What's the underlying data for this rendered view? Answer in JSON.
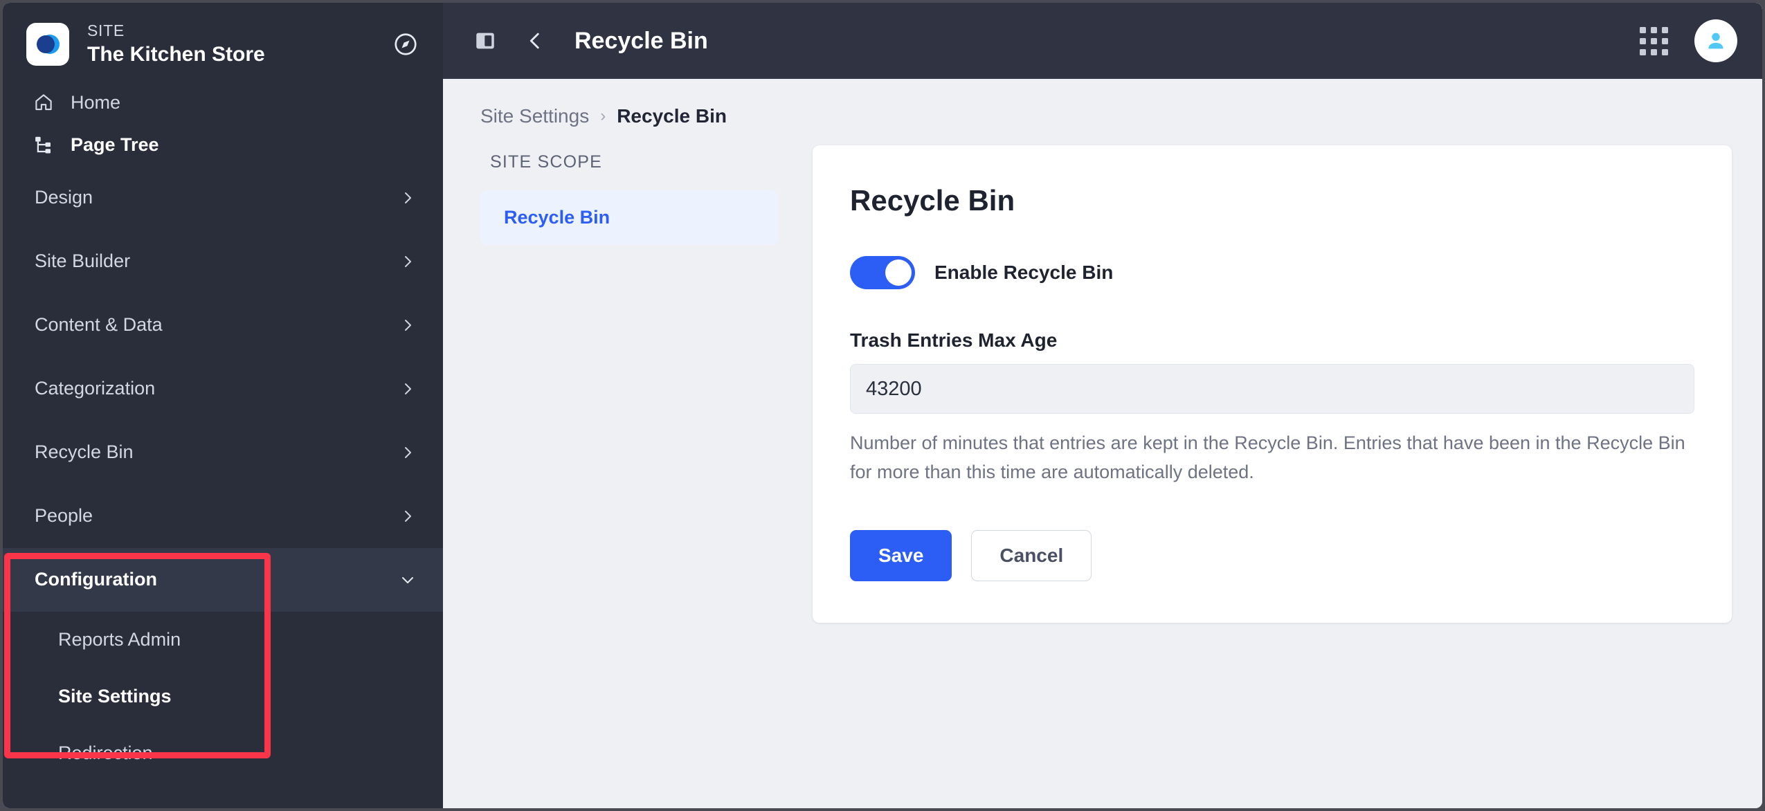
{
  "sidebar": {
    "site_eyebrow": "SITE",
    "site_title": "The Kitchen Store",
    "compass_icon": "compass-icon",
    "top_items": [
      {
        "label": "Home",
        "icon": "home-icon"
      },
      {
        "label": "Page Tree",
        "icon": "page-tree-icon"
      }
    ],
    "groups": [
      {
        "label": "Design",
        "chevron": "chevron-right-icon"
      },
      {
        "label": "Site Builder",
        "chevron": "chevron-right-icon"
      },
      {
        "label": "Content & Data",
        "chevron": "chevron-right-icon"
      },
      {
        "label": "Categorization",
        "chevron": "chevron-right-icon"
      },
      {
        "label": "Recycle Bin",
        "chevron": "chevron-right-icon"
      },
      {
        "label": "People",
        "chevron": "chevron-right-icon"
      }
    ],
    "configuration": {
      "label": "Configuration",
      "chevron": "chevron-down-icon",
      "children": [
        {
          "label": "Reports Admin",
          "active": false
        },
        {
          "label": "Site Settings",
          "active": true
        }
      ]
    },
    "after_configuration": [
      {
        "label": "Redirection"
      }
    ],
    "highlight_color": "#fa3449",
    "background_color": "#2a2e3b"
  },
  "topbar": {
    "sidebar_toggle_icon": "sidebar-toggle-icon",
    "back_icon": "chevron-left-icon",
    "title": "Recycle Bin",
    "apps_icon": "apps-grid-icon",
    "avatar_icon": "user-avatar-icon"
  },
  "breadcrumb": {
    "parent": "Site Settings",
    "separator": "›",
    "current": "Recycle Bin"
  },
  "scope_nav": {
    "title": "SITE SCOPE",
    "items": [
      {
        "label": "Recycle Bin",
        "active": true
      }
    ],
    "active_color": "#2c5ef5"
  },
  "card": {
    "title": "Recycle Bin",
    "toggle": {
      "label": "Enable Recycle Bin",
      "enabled": true,
      "on_color": "#2c5ef5"
    },
    "field": {
      "label": "Trash Entries Max Age",
      "value": "43200",
      "placeholder": "",
      "help": "Number of minutes that entries are kept in the Recycle Bin. Entries that have been in the Recycle Bin for more than this time are automatically deleted."
    },
    "buttons": {
      "save": "Save",
      "cancel": "Cancel"
    }
  }
}
